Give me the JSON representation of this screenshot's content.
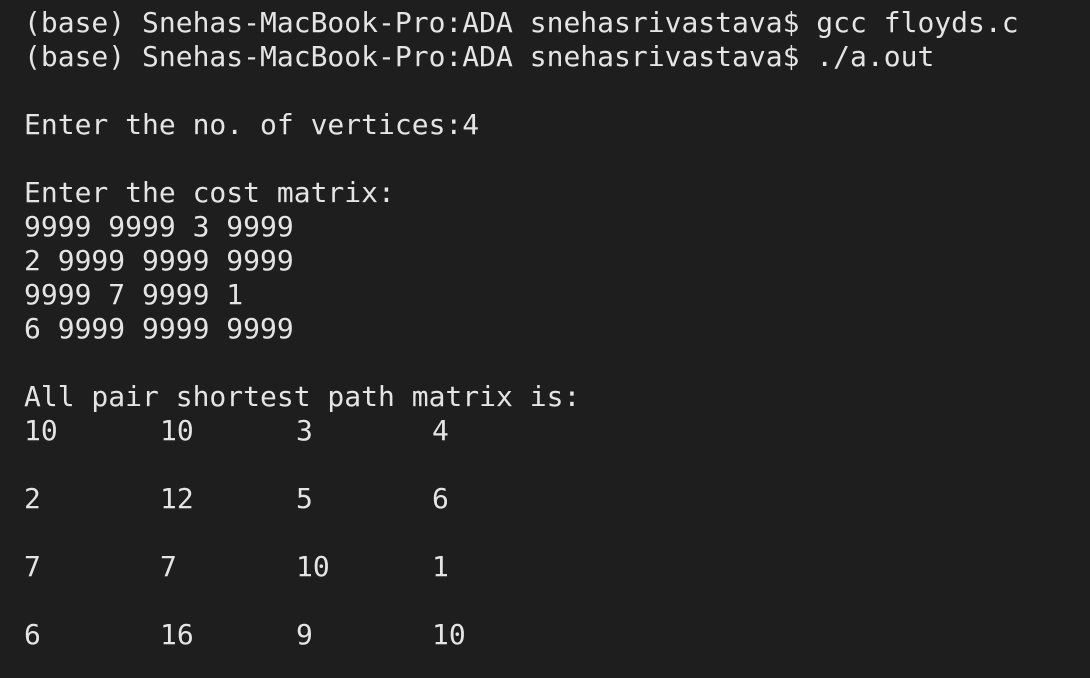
{
  "terminal": {
    "prompt1": "(base) Snehas-MacBook-Pro:ADA snehasrivastava$ gcc floyds.c",
    "prompt2": "(base) Snehas-MacBook-Pro:ADA snehasrivastava$ ./a.out",
    "vertices_prompt": "Enter the no. of vertices:4",
    "cost_prompt": "Enter the cost matrix:",
    "cost_rows": [
      "9999 9999 3 9999",
      "2 9999 9999 9999",
      "9999 7 9999 1",
      "6 9999 9999 9999"
    ],
    "result_heading": "All pair shortest path matrix is:",
    "result_matrix": [
      [
        "10",
        "10",
        "3",
        "4"
      ],
      [
        "2",
        "12",
        "5",
        "6"
      ],
      [
        "7",
        "7",
        "10",
        "1"
      ],
      [
        "6",
        "16",
        "9",
        "10"
      ]
    ]
  },
  "colors": {
    "background": "#1e1e1e",
    "text": "#e4e4e4"
  }
}
